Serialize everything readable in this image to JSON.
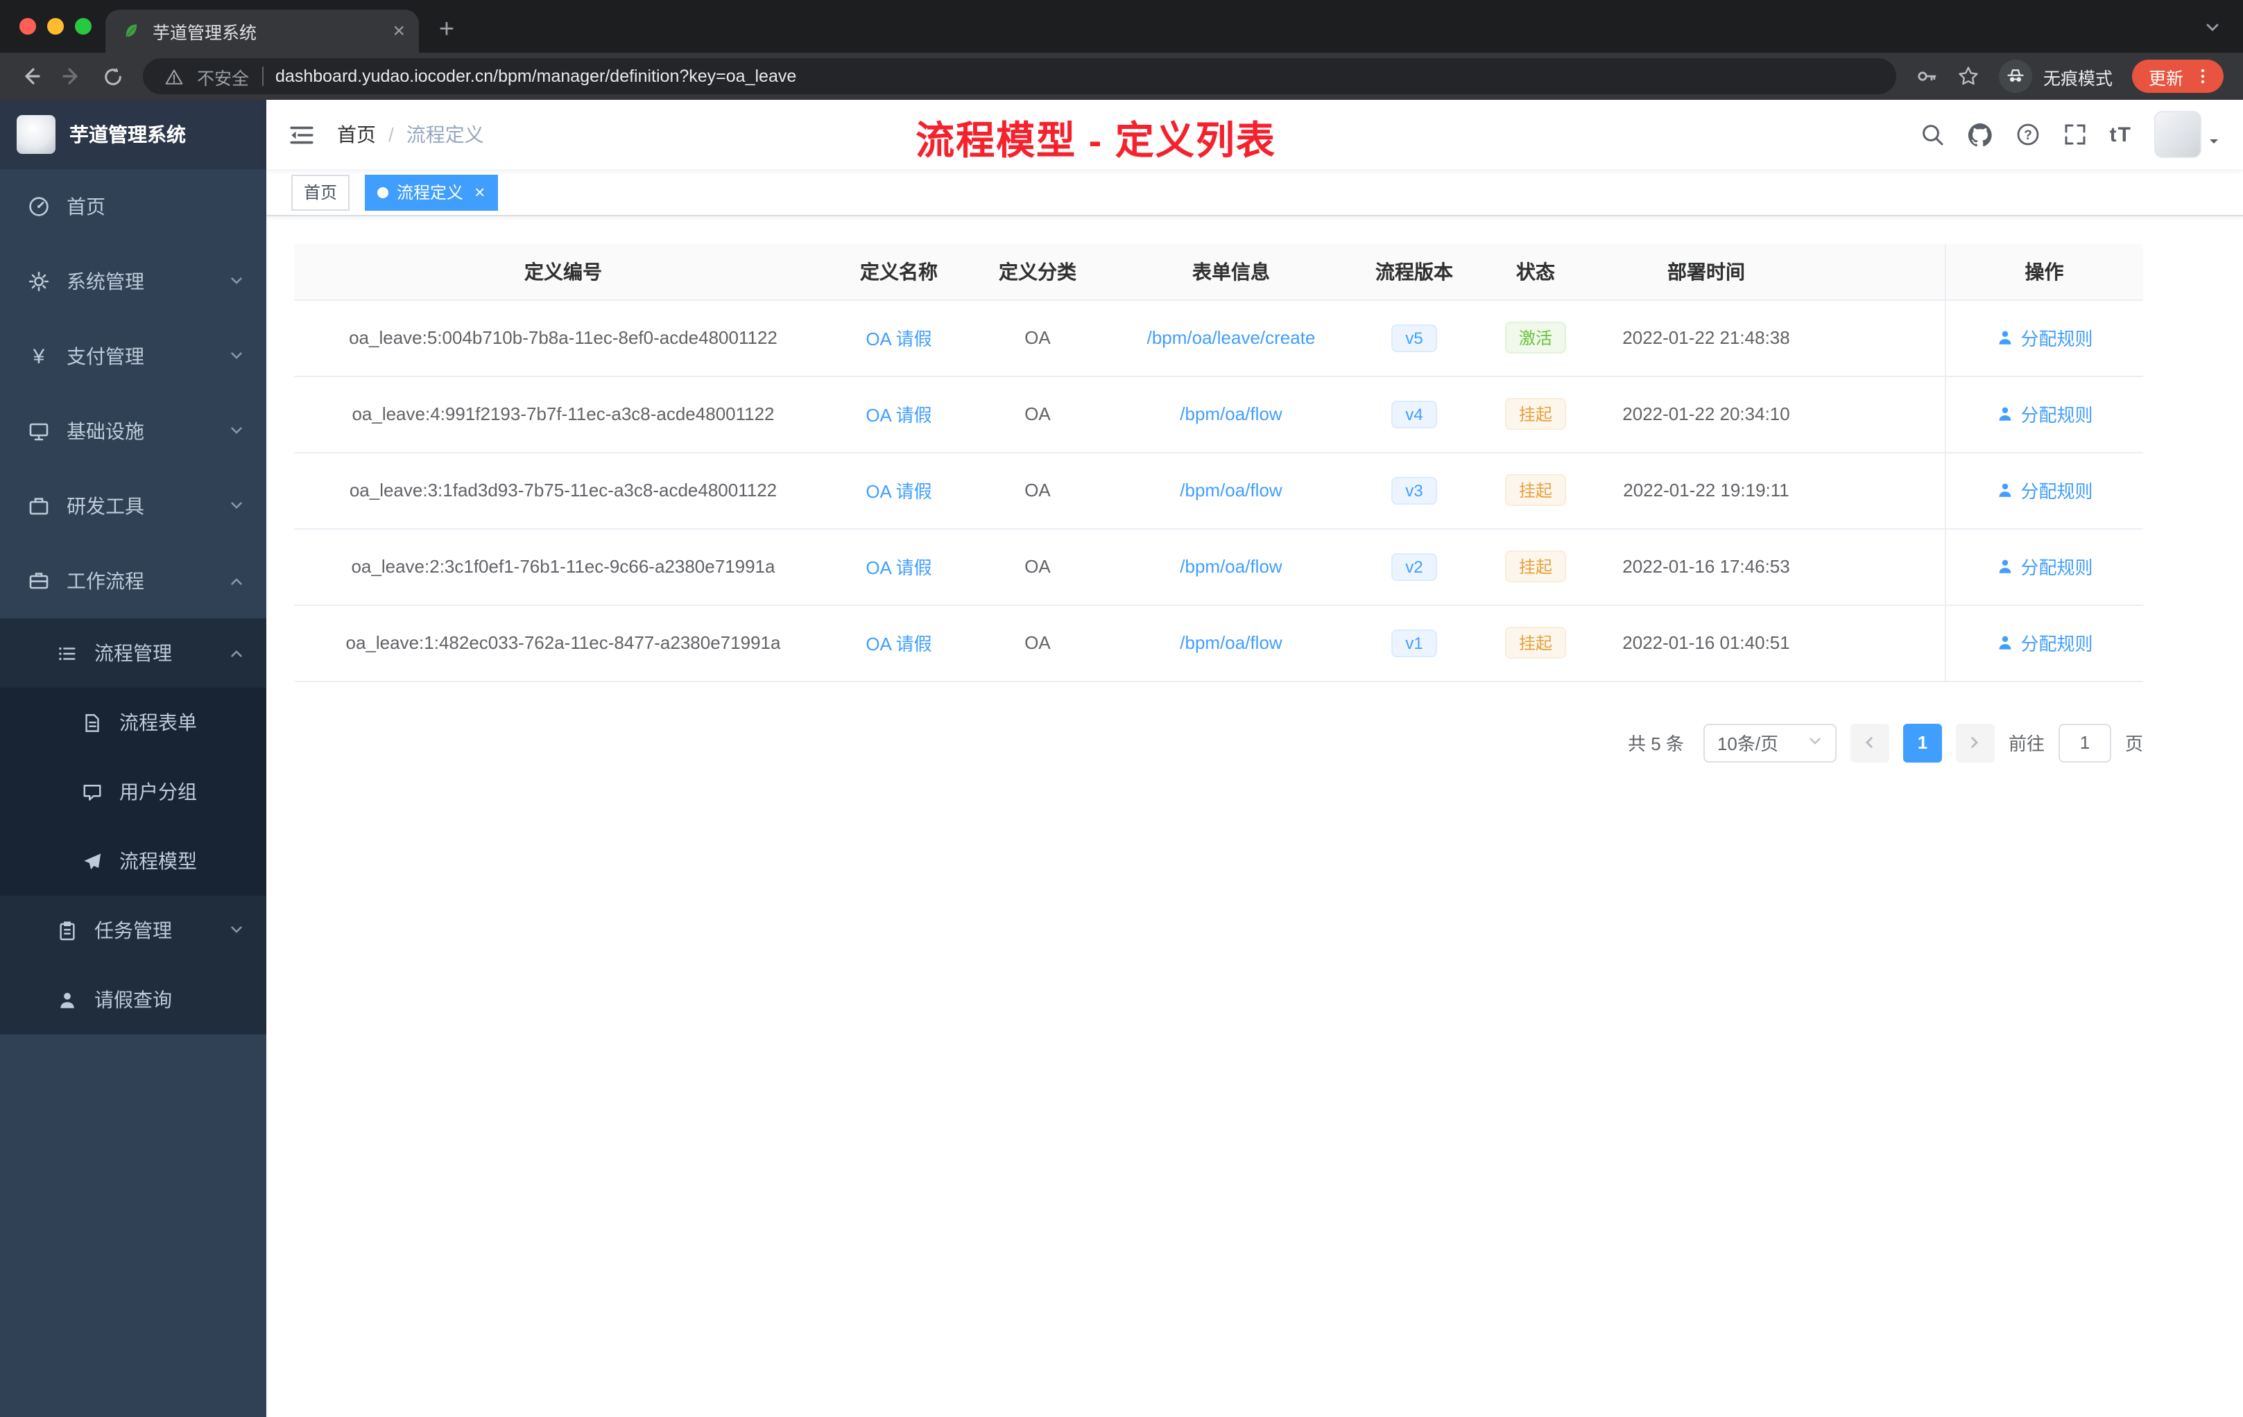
{
  "colors": {
    "accent_blue": "#409eff",
    "active_green": "#67c23a",
    "suspend_orange": "#e6a23c",
    "annotation_red": "#f5222d",
    "sidebar_bg": "#304156",
    "submenu_bg": "#1f2d3d",
    "update_pill": "#e8543f",
    "active_tag_bg": "#409eff"
  },
  "browser": {
    "tab_title": "芋道管理系统",
    "security_label": "不安全",
    "url": "dashboard.yudao.iocoder.cn/bpm/manager/definition?key=oa_leave",
    "incognito_label": "无痕模式",
    "update_label": "更新"
  },
  "sidebar": {
    "logo_title": "芋道管理系统",
    "items": [
      {
        "label": "首页"
      },
      {
        "label": "系统管理"
      },
      {
        "label": "支付管理"
      },
      {
        "label": "基础设施"
      },
      {
        "label": "研发工具"
      },
      {
        "label": "工作流程"
      }
    ],
    "workflow": {
      "process_mgmt": {
        "label": "流程管理"
      },
      "process_children": [
        {
          "label": "流程表单"
        },
        {
          "label": "用户分组"
        },
        {
          "label": "流程模型"
        }
      ],
      "task_mgmt": {
        "label": "任务管理"
      },
      "leave_query": {
        "label": "请假查询"
      }
    }
  },
  "navbar": {
    "breadcrumb": [
      {
        "label": "首页"
      },
      {
        "label": "流程定义"
      }
    ],
    "separator": "/",
    "annotation": "流程模型 - 定义列表"
  },
  "tags": [
    {
      "label": "首页"
    },
    {
      "label": "流程定义"
    }
  ],
  "table": {
    "columns": [
      "定义编号",
      "定义名称",
      "定义分类",
      "表单信息",
      "流程版本",
      "状态",
      "部署时间",
      "操作"
    ],
    "rows": [
      {
        "id": "oa_leave:5:004b710b-7b8a-11ec-8ef0-acde48001122",
        "name": "OA 请假",
        "category": "OA",
        "form": "/bpm/oa/leave/create",
        "version": "v5",
        "status": "激活",
        "deployed": "2022-01-22 21:48:38",
        "action": "分配规则"
      },
      {
        "id": "oa_leave:4:991f2193-7b7f-11ec-a3c8-acde48001122",
        "name": "OA 请假",
        "category": "OA",
        "form": "/bpm/oa/flow",
        "version": "v4",
        "status": "挂起",
        "deployed": "2022-01-22 20:34:10",
        "action": "分配规则"
      },
      {
        "id": "oa_leave:3:1fad3d93-7b75-11ec-a3c8-acde48001122",
        "name": "OA 请假",
        "category": "OA",
        "form": "/bpm/oa/flow",
        "version": "v3",
        "status": "挂起",
        "deployed": "2022-01-22 19:19:11",
        "action": "分配规则"
      },
      {
        "id": "oa_leave:2:3c1f0ef1-76b1-11ec-9c66-a2380e71991a",
        "name": "OA 请假",
        "category": "OA",
        "form": "/bpm/oa/flow",
        "version": "v2",
        "status": "挂起",
        "deployed": "2022-01-16 17:46:53",
        "action": "分配规则"
      },
      {
        "id": "oa_leave:1:482ec033-762a-11ec-8477-a2380e71991a",
        "name": "OA 请假",
        "category": "OA",
        "form": "/bpm/oa/flow",
        "version": "v1",
        "status": "挂起",
        "deployed": "2022-01-16 01:40:51",
        "action": "分配规则"
      }
    ]
  },
  "pagination": {
    "total": "共 5 条",
    "page_size": "10条/页",
    "page": "1",
    "goto_label": "前往",
    "goto_value": "1",
    "unit": "页"
  }
}
